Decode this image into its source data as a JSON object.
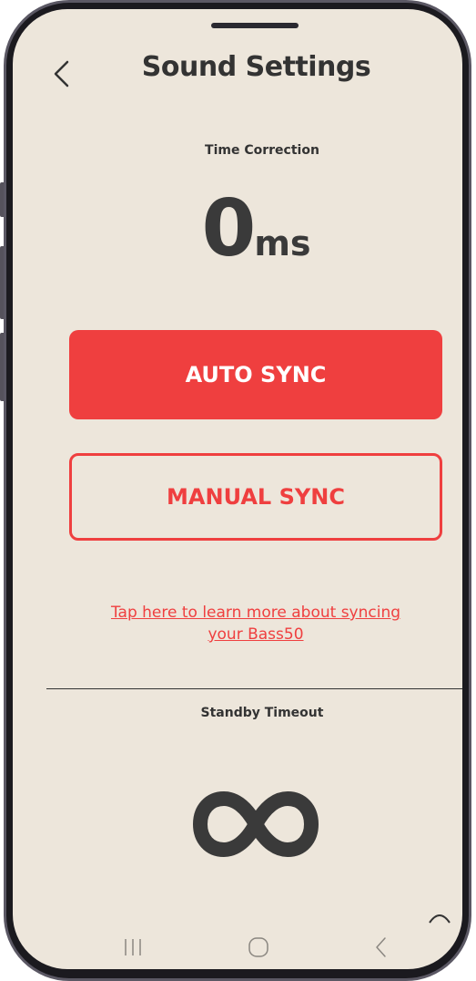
{
  "header": {
    "title": "Sound Settings",
    "back_icon": "chevron-left-icon"
  },
  "time_correction": {
    "label": "Time Correction",
    "value": "0",
    "unit": "ms"
  },
  "buttons": {
    "auto_sync": "AUTO SYNC",
    "manual_sync": "MANUAL SYNC"
  },
  "learn_more": {
    "line1": "Tap here to learn more about syncing",
    "line2": "your Bass50"
  },
  "standby": {
    "label": "Standby Timeout",
    "value_icon": "infinity-icon"
  },
  "system_nav": {
    "recents_icon": "recents-icon",
    "home_icon": "home-icon",
    "back_icon": "back-icon"
  },
  "colors": {
    "background": "#ede6db",
    "accent": "#ef3f3f",
    "text": "#333333",
    "frame": "#1b1a1f"
  }
}
